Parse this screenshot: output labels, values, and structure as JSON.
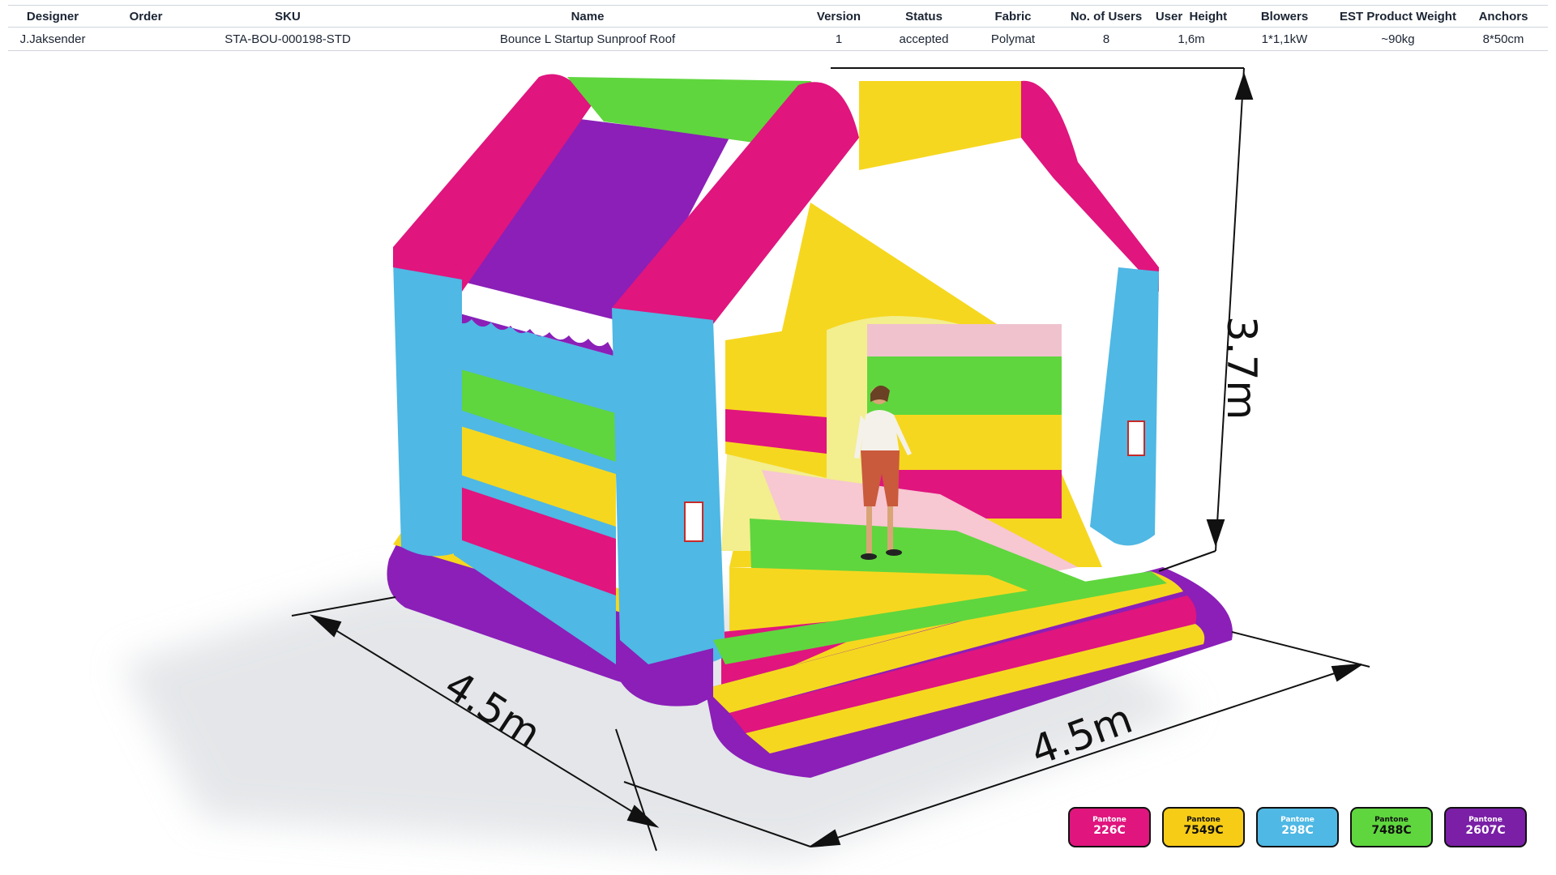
{
  "spec": {
    "headers": [
      "Designer",
      "Order",
      "SKU",
      "Name",
      "Version",
      "Status",
      "Fabric",
      "No. of Users",
      "User  Height",
      "Blowers",
      "EST Product Weight",
      "Anchors"
    ],
    "row": [
      "J.Jaksender",
      "",
      "STA-BOU-000198-STD",
      "Bounce L Startup Sunproof Roof",
      "1",
      "accepted",
      "Polymat",
      "8",
      "1,6m",
      "1*1,1kW",
      "~90kg",
      "8*50cm"
    ]
  },
  "dimensions": {
    "height": "3.7m",
    "depth": "4.5m",
    "width": "4.5m"
  },
  "palette": [
    {
      "brand": "Pantone",
      "code": "226C",
      "color": "#e0157e",
      "text": "light"
    },
    {
      "brand": "Pantone",
      "code": "7549C",
      "color": "#f7cc17",
      "text": "dark"
    },
    {
      "brand": "Pantone",
      "code": "298C",
      "color": "#4fb8e4",
      "text": "light"
    },
    {
      "brand": "Pantone",
      "code": "7488C",
      "color": "#5fd63e",
      "text": "dark"
    },
    {
      "brand": "Pantone",
      "code": "2607C",
      "color": "#7a1fa6",
      "text": "light"
    }
  ]
}
